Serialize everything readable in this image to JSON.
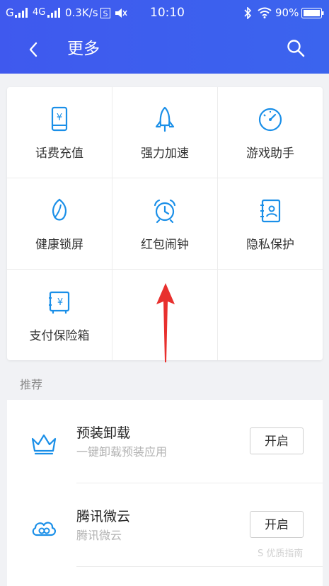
{
  "status_bar": {
    "carrier": "G",
    "network": "4G",
    "speed": "0.3K/s",
    "time": "10:10",
    "battery": "90%"
  },
  "nav": {
    "title": "更多",
    "back_icon": "chevron-left-icon",
    "search_icon": "search-icon"
  },
  "grid": {
    "items": [
      {
        "label": "话费充值",
        "icon": "phone-recharge-icon"
      },
      {
        "label": "强力加速",
        "icon": "rocket-icon"
      },
      {
        "label": "游戏助手",
        "icon": "gauge-icon"
      },
      {
        "label": "健康锁屏",
        "icon": "leaf-icon"
      },
      {
        "label": "红包闹钟",
        "icon": "alarm-clock-icon"
      },
      {
        "label": "隐私保护",
        "icon": "contact-book-icon"
      },
      {
        "label": "支付保险箱",
        "icon": "safe-icon"
      }
    ]
  },
  "recommend": {
    "title": "推荐",
    "items": [
      {
        "name": "预装卸载",
        "desc": "一键卸载预装应用",
        "button": "开启",
        "icon": "crown-icon"
      },
      {
        "name": "腾讯微云",
        "desc": "腾讯微云",
        "button": "开启",
        "icon": "cloud-icon"
      }
    ]
  },
  "watermark": "S 优质指南",
  "colors": {
    "header": "#3f59ee",
    "accent": "#1a8fe8",
    "annotation_arrow": "#e8302e"
  }
}
